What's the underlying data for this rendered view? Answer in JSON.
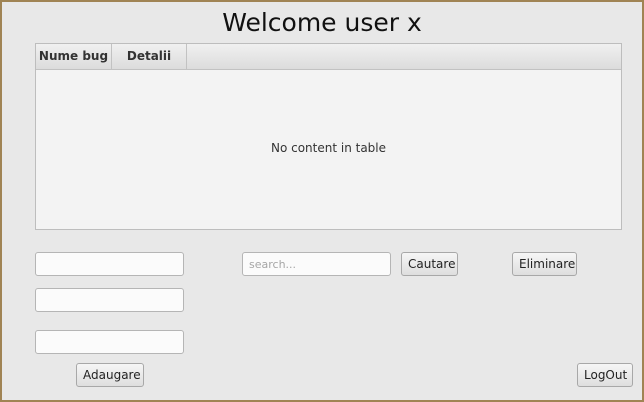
{
  "window": {
    "title": "Welcome user x"
  },
  "table": {
    "columns": [
      "Nume bug",
      "Detalii"
    ],
    "empty_message": "No content in table"
  },
  "form": {
    "field_1_value": "",
    "field_2_value": "",
    "field_3_value": "",
    "add_label": "Adaugare"
  },
  "search": {
    "value": "",
    "placeholder": "search...",
    "button_label": "Cautare"
  },
  "actions": {
    "delete_label": "Eliminare",
    "logout_label": "LogOut"
  },
  "colors": {
    "window_background": "#e8e8e8",
    "window_border": "#a08454",
    "table_background": "#f3f3f3"
  }
}
